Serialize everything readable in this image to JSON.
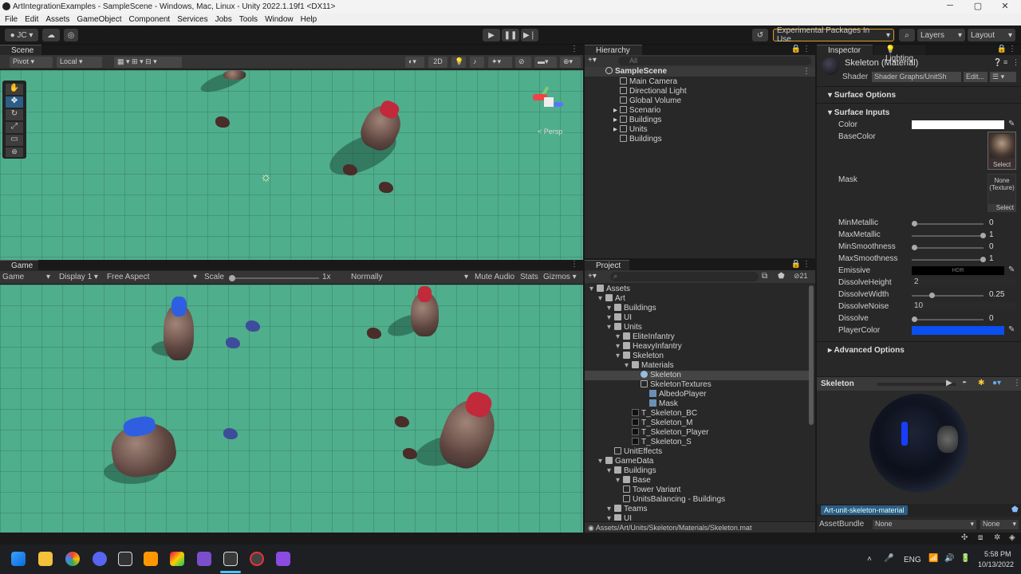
{
  "window": {
    "title": "ArtIntegrationExamples - SampleScene - Windows, Mac, Linux - Unity 2022.1.19f1 <DX11>"
  },
  "menu": [
    "File",
    "Edit",
    "Assets",
    "GameObject",
    "Component",
    "Services",
    "Jobs",
    "Tools",
    "Window",
    "Help"
  ],
  "toolbar": {
    "account": "JC",
    "experimental": "Experimental Packages In Use",
    "layers": "Layers",
    "layout": "Layout"
  },
  "scene": {
    "tab": "Scene",
    "pivot": "Pivot",
    "local": "Local",
    "mode2d": "2D",
    "persp": "< Persp"
  },
  "game": {
    "tab": "Game",
    "view": "Game",
    "display": "Display 1",
    "aspect": "Free Aspect",
    "scale_label": "Scale",
    "scale_value": "1x",
    "normally": "Normally",
    "mute": "Mute Audio",
    "stats": "Stats",
    "gizmos": "Gizmos"
  },
  "hierarchy": {
    "tab": "Hierarchy",
    "search_placeholder": "All",
    "scene_name": "SampleScene",
    "items": [
      "Main Camera",
      "Directional Light",
      "Global Volume",
      "Scenario",
      "Buildings",
      "Units",
      "Buildings"
    ]
  },
  "project": {
    "tab": "Project",
    "count": "21",
    "tree": [
      {
        "label": "Assets",
        "indent": 0,
        "type": "folder"
      },
      {
        "label": "Art",
        "indent": 1,
        "type": "folder"
      },
      {
        "label": "Buildings",
        "indent": 2,
        "type": "folder"
      },
      {
        "label": "UI",
        "indent": 2,
        "type": "folder"
      },
      {
        "label": "Units",
        "indent": 2,
        "type": "folder"
      },
      {
        "label": "EliteInfantry",
        "indent": 3,
        "type": "folder"
      },
      {
        "label": "HeavyInfantry",
        "indent": 3,
        "type": "folder"
      },
      {
        "label": "Skeleton",
        "indent": 3,
        "type": "folder"
      },
      {
        "label": "Materials",
        "indent": 4,
        "type": "folder"
      },
      {
        "label": "Skeleton",
        "indent": 5,
        "type": "material",
        "selected": true
      },
      {
        "label": "SkeletonTextures",
        "indent": 5,
        "type": "asset"
      },
      {
        "label": "AlbedoPlayer",
        "indent": 6,
        "type": "texture"
      },
      {
        "label": "Mask",
        "indent": 6,
        "type": "texture"
      },
      {
        "label": "T_Skeleton_BC",
        "indent": 4,
        "type": "image"
      },
      {
        "label": "T_Skeleton_M",
        "indent": 4,
        "type": "image"
      },
      {
        "label": "T_Skeleton_Player",
        "indent": 4,
        "type": "image"
      },
      {
        "label": "T_Skeleton_S",
        "indent": 4,
        "type": "image"
      },
      {
        "label": "UnitEffects",
        "indent": 2,
        "type": "asset"
      },
      {
        "label": "GameData",
        "indent": 1,
        "type": "folder"
      },
      {
        "label": "Buildings",
        "indent": 2,
        "type": "folder"
      },
      {
        "label": "Base",
        "indent": 3,
        "type": "folder"
      },
      {
        "label": "Tower Variant",
        "indent": 3,
        "type": "asset"
      },
      {
        "label": "UnitsBalancing - Buildings",
        "indent": 3,
        "type": "asset"
      },
      {
        "label": "Teams",
        "indent": 2,
        "type": "folder"
      },
      {
        "label": "UI",
        "indent": 2,
        "type": "folder"
      }
    ],
    "path": "Assets/Art/Units/Skeleton/Materials/Skeleton.mat"
  },
  "inspector": {
    "tab": "Inspector",
    "tab2": "Lighting",
    "material_name": "Skeleton (Material)",
    "shader_label": "Shader",
    "shader_value": "Shader Graphs/UnitSh",
    "edit": "Edit...",
    "surface_options": "Surface Options",
    "surface_inputs": "Surface Inputs",
    "color_label": "Color",
    "basecolor_label": "BaseColor",
    "mask_label": "Mask",
    "mask_none": "None (Texture)",
    "select": "Select",
    "sliders": [
      {
        "label": "MinMetallic",
        "value": "0",
        "fraction": 0.0
      },
      {
        "label": "MaxMetallic",
        "value": "1",
        "fraction": 1.0
      },
      {
        "label": "MinSmoothness",
        "value": "0",
        "fraction": 0.0
      },
      {
        "label": "MaxSmoothness",
        "value": "1",
        "fraction": 1.0
      }
    ],
    "emissive_label": "Emissive",
    "hdr": "HDR",
    "dissolve_height_label": "DissolveHeight",
    "dissolve_height": "2",
    "dissolve_width_label": "DissolveWidth",
    "dissolve_width": "0.25",
    "dissolve_width_fraction": 0.25,
    "dissolve_noise_label": "DissolveNoise",
    "dissolve_noise": "10",
    "dissolve_label": "Dissolve",
    "dissolve": "0",
    "dissolve_fraction": 0.0,
    "player_color_label": "PlayerColor",
    "player_color": "#0a4ff0",
    "advanced": "Advanced Options",
    "preview_title": "Skeleton",
    "label_tag": "Art-unit-skeleton-material",
    "assetbundle_label": "AssetBundle",
    "assetbundle_value": "None",
    "variant_value": "None"
  },
  "taskbar": {
    "lang": "ENG",
    "time": "5:58 PM",
    "date": "10/13/2022"
  },
  "colors": {
    "accent": "#2c5d87",
    "ground": "#4fae8c",
    "tower_cap": "#c2293a"
  }
}
